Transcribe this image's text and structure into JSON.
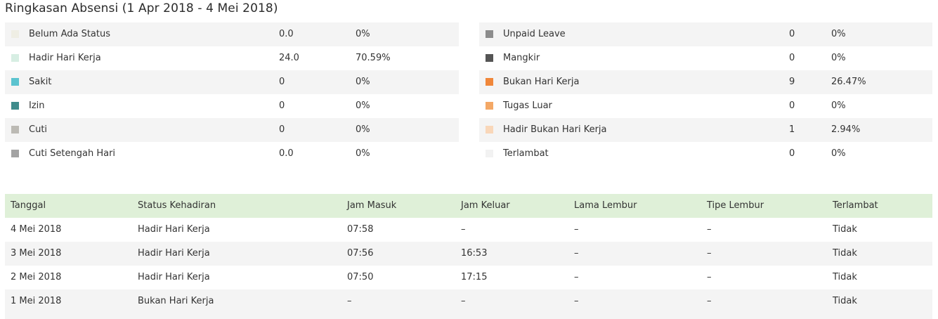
{
  "title": "Ringkasan Absensi (1 Apr 2018 - 4 Mei 2018)",
  "summary_left": [
    {
      "label": "Belum Ada Status",
      "count": "0.0",
      "percent": "0%",
      "color": "#efeee4"
    },
    {
      "label": "Hadir Hari Kerja",
      "count": "24.0",
      "percent": "70.59%",
      "color": "#d7eee3"
    },
    {
      "label": "Sakit",
      "count": "0",
      "percent": "0%",
      "color": "#5bc3cf"
    },
    {
      "label": "Izin",
      "count": "0",
      "percent": "0%",
      "color": "#3f8c8c"
    },
    {
      "label": "Cuti",
      "count": "0",
      "percent": "0%",
      "color": "#bcbab4"
    },
    {
      "label": "Cuti Setengah Hari",
      "count": "0.0",
      "percent": "0%",
      "color": "#a3a3a3"
    }
  ],
  "summary_right": [
    {
      "label": "Unpaid Leave",
      "count": "0",
      "percent": "0%",
      "color": "#8c8c8c"
    },
    {
      "label": "Mangkir",
      "count": "0",
      "percent": "0%",
      "color": "#555555"
    },
    {
      "label": "Bukan Hari Kerja",
      "count": "9",
      "percent": "26.47%",
      "color": "#f0873a"
    },
    {
      "label": "Tugas Luar",
      "count": "0",
      "percent": "0%",
      "color": "#f4a866"
    },
    {
      "label": "Hadir Bukan Hari Kerja",
      "count": "1",
      "percent": "2.94%",
      "color": "#f9d7b9"
    },
    {
      "label": "Terlambat",
      "count": "0",
      "percent": "0%",
      "color": "#f2f2f2"
    }
  ],
  "table": {
    "headers": [
      "Tanggal",
      "Status Kehadiran",
      "Jam Masuk",
      "Jam Keluar",
      "Lama Lembur",
      "Tipe Lembur",
      "Terlambat"
    ],
    "rows": [
      [
        "4 Mei 2018",
        "Hadir Hari Kerja",
        "07:58",
        "–",
        "–",
        "–",
        "Tidak"
      ],
      [
        "3 Mei 2018",
        "Hadir Hari Kerja",
        "07:56",
        "16:53",
        "–",
        "–",
        "Tidak"
      ],
      [
        "2 Mei 2018",
        "Hadir Hari Kerja",
        "07:50",
        "17:15",
        "–",
        "–",
        "Tidak"
      ],
      [
        "1 Mei 2018",
        "Bukan Hari Kerja",
        "–",
        "–",
        "–",
        "–",
        "Tidak"
      ]
    ]
  }
}
